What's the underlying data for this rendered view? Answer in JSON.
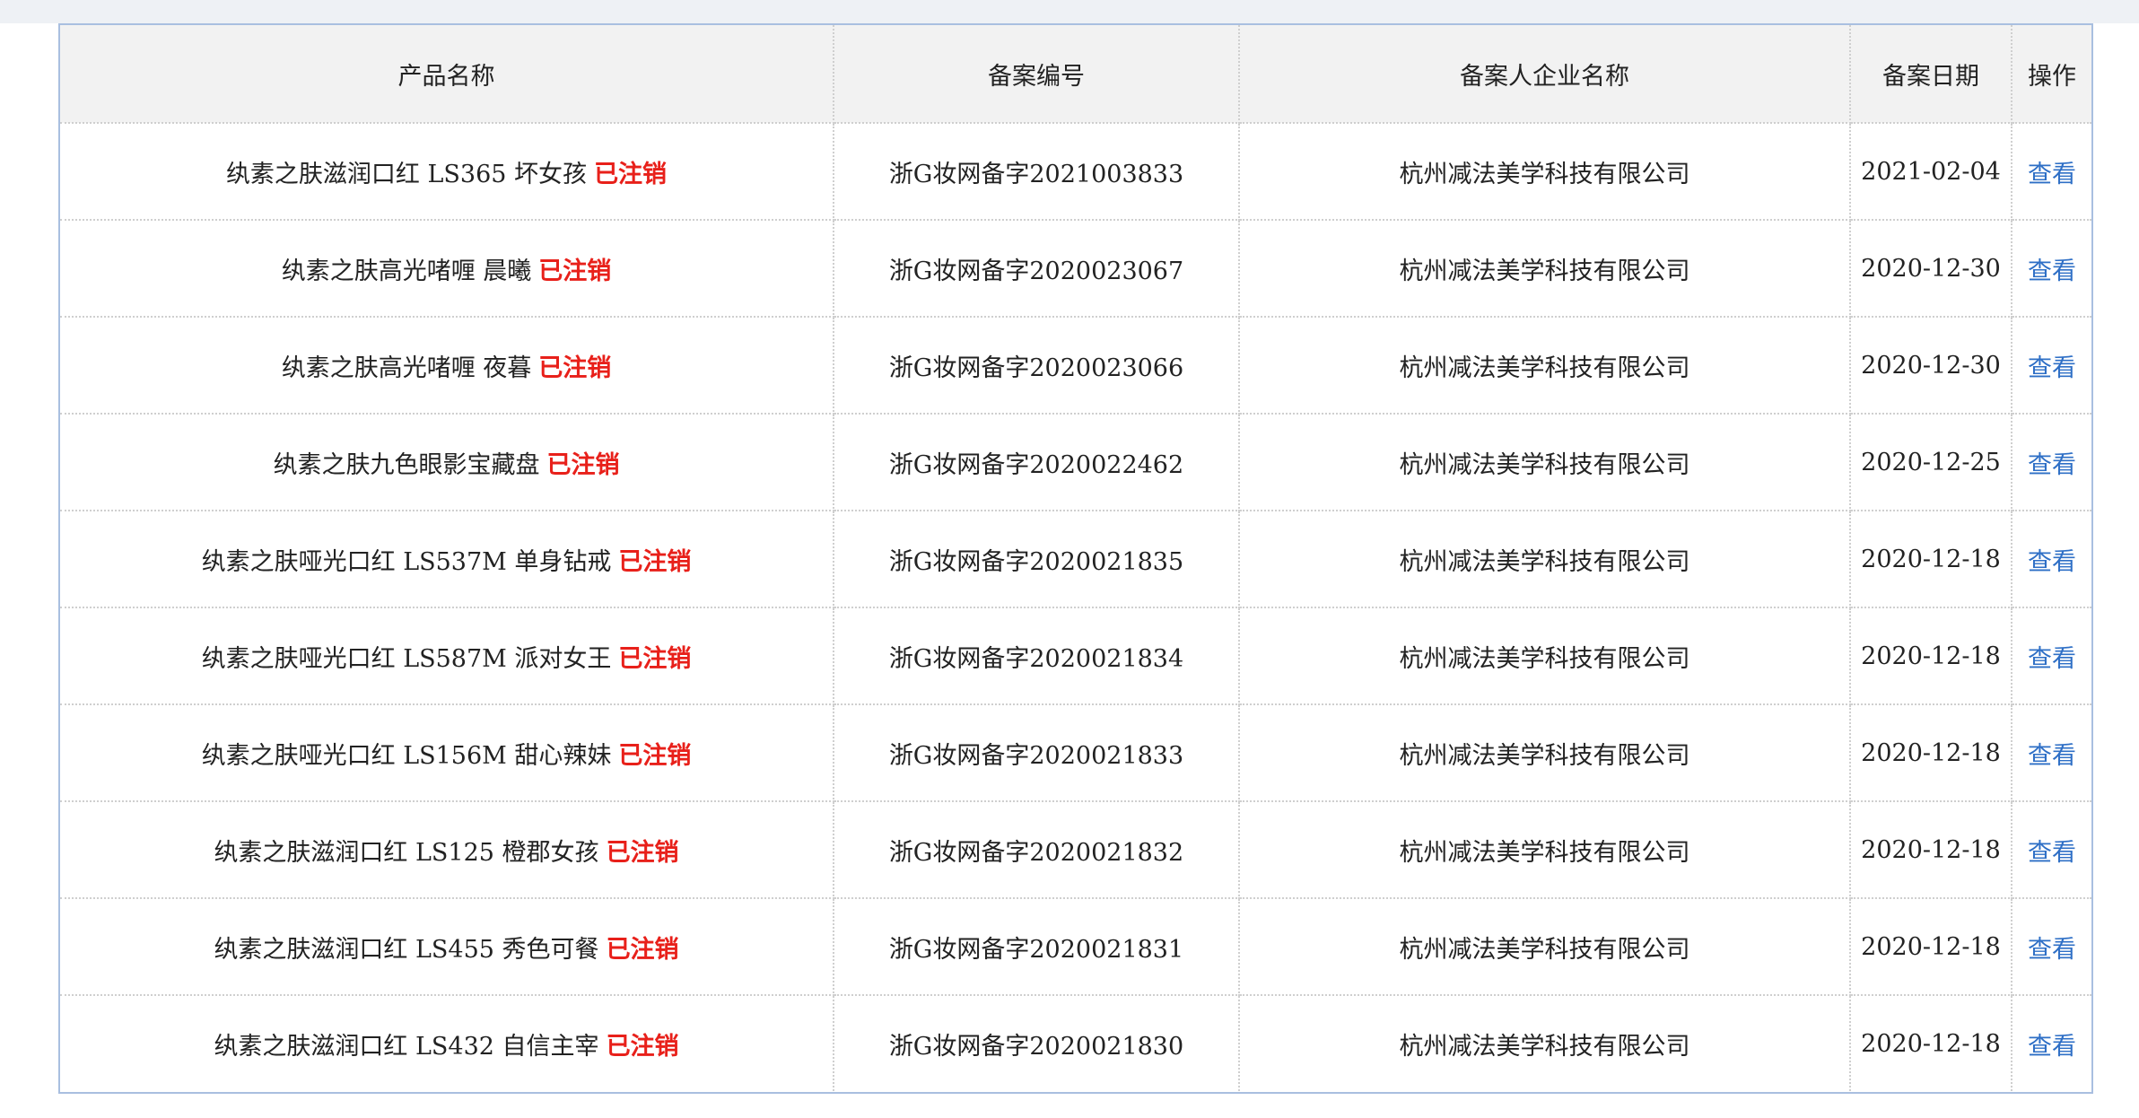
{
  "table": {
    "headers": [
      "产品名称",
      "备案编号",
      "备案人企业名称",
      "备案日期",
      "操作"
    ],
    "rows": [
      {
        "name": "纨素之肤滋润口红 LS365 坏女孩",
        "status": "已注销",
        "record_no": "浙G妆网备字2021003833",
        "company": "杭州减法美学科技有限公司",
        "date": "2021-02-04",
        "action": "查看"
      },
      {
        "name": "纨素之肤高光啫喱 晨曦",
        "status": "已注销",
        "record_no": "浙G妆网备字2020023067",
        "company": "杭州减法美学科技有限公司",
        "date": "2020-12-30",
        "action": "查看"
      },
      {
        "name": "纨素之肤高光啫喱 夜暮",
        "status": "已注销",
        "record_no": "浙G妆网备字2020023066",
        "company": "杭州减法美学科技有限公司",
        "date": "2020-12-30",
        "action": "查看"
      },
      {
        "name": "纨素之肤九色眼影宝藏盘",
        "status": "已注销",
        "record_no": "浙G妆网备字2020022462",
        "company": "杭州减法美学科技有限公司",
        "date": "2020-12-25",
        "action": "查看"
      },
      {
        "name": "纨素之肤哑光口红 LS537M 单身钻戒",
        "status": "已注销",
        "record_no": "浙G妆网备字2020021835",
        "company": "杭州减法美学科技有限公司",
        "date": "2020-12-18",
        "action": "查看"
      },
      {
        "name": "纨素之肤哑光口红 LS587M 派对女王",
        "status": "已注销",
        "record_no": "浙G妆网备字2020021834",
        "company": "杭州减法美学科技有限公司",
        "date": "2020-12-18",
        "action": "查看"
      },
      {
        "name": "纨素之肤哑光口红 LS156M 甜心辣妹",
        "status": "已注销",
        "record_no": "浙G妆网备字2020021833",
        "company": "杭州减法美学科技有限公司",
        "date": "2020-12-18",
        "action": "查看"
      },
      {
        "name": "纨素之肤滋润口红 LS125 橙郡女孩",
        "status": "已注销",
        "record_no": "浙G妆网备字2020021832",
        "company": "杭州减法美学科技有限公司",
        "date": "2020-12-18",
        "action": "查看"
      },
      {
        "name": "纨素之肤滋润口红 LS455 秀色可餐",
        "status": "已注销",
        "record_no": "浙G妆网备字2020021831",
        "company": "杭州减法美学科技有限公司",
        "date": "2020-12-18",
        "action": "查看"
      },
      {
        "name": "纨素之肤滋润口红 LS432 自信主宰",
        "status": "已注销",
        "record_no": "浙G妆网备字2020021830",
        "company": "杭州减法美学科技有限公司",
        "date": "2020-12-18",
        "action": "查看"
      }
    ]
  },
  "colors": {
    "status_red": "#e8201a",
    "link_blue": "#2e6fc6",
    "header_bg": "#f2f2f2",
    "table_border": "#a9bfe0"
  }
}
